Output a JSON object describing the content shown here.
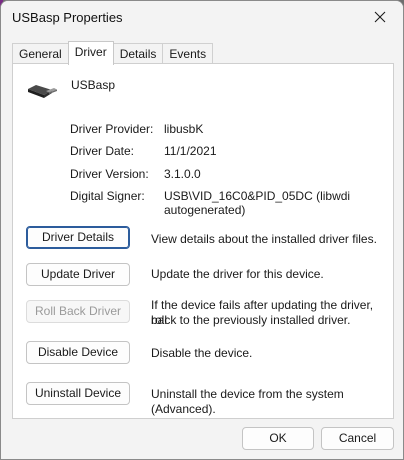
{
  "window": {
    "title": "USBasp Properties",
    "close_label": "✕"
  },
  "tabs": [
    {
      "label": "General",
      "active": false
    },
    {
      "label": "Driver",
      "active": true
    },
    {
      "label": "Details",
      "active": false
    },
    {
      "label": "Events",
      "active": false
    }
  ],
  "device": {
    "name": "USBasp",
    "icon": "usb-cable-icon"
  },
  "properties": [
    {
      "label": "Driver Provider:",
      "value": "libusbK"
    },
    {
      "label": "Driver Date:",
      "value": "11/1/2021"
    },
    {
      "label": "Driver Version:",
      "value": "3.1.0.0"
    },
    {
      "label": "Digital Signer:",
      "value_line1": "USB\\VID_16C0&PID_05DC (libwdi",
      "value_line2": "autogenerated)"
    }
  ],
  "actions": [
    {
      "label": "Driver Details",
      "description": "View details about the installed driver files.",
      "focused": true,
      "enabled": true
    },
    {
      "label": "Update Driver",
      "description": "Update the driver for this device.",
      "enabled": true
    },
    {
      "label": "Roll Back Driver",
      "description_line1": "If the device fails after updating the driver, roll",
      "description_line2": "back to the previously installed driver.",
      "enabled": false
    },
    {
      "label": "Disable Device",
      "description": "Disable the device.",
      "enabled": true
    },
    {
      "label": "Uninstall Device",
      "description": "Uninstall the device from the system (Advanced).",
      "enabled": true
    }
  ],
  "footer": {
    "ok_label": "OK",
    "cancel_label": "Cancel"
  },
  "colors": {
    "focus_border": "#2c5c9c",
    "disabled_text": "#9a9a9a",
    "window_bg": "#f3f3f3"
  }
}
